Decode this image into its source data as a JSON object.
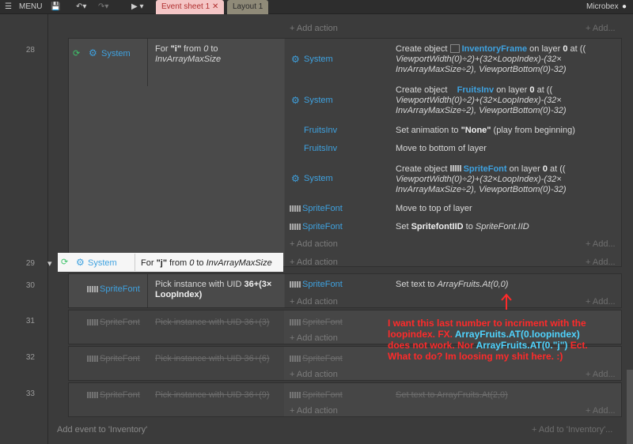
{
  "toolbar": {
    "menu_label": "MENU",
    "tab_active": "Event sheet 1",
    "tab_inactive": "Layout 1",
    "user": "Microbex"
  },
  "events": {
    "e28": {
      "num": "28",
      "cond_object": "System",
      "cond_text_1": "For ",
      "cond_var": "\"i\"",
      "cond_text_2": " from ",
      "cond_from": "0",
      "cond_text_3": " to",
      "cond_to": "InvArrayMaxSize",
      "actions": [
        {
          "object": "System",
          "line1": "Create object",
          "obj": "InventoryFrame",
          "line1b": "on layer",
          "layer": "0",
          "line1c": "at ((",
          "line2": "ViewportWidth(0)÷2)+(32×LoopIndex)-(32×",
          "line3": "InvArrayMaxSize÷2), ViewportBottom(0)-32)"
        },
        {
          "object": "System",
          "line1": "Create object",
          "obj": "FruitsInv",
          "line1b": "on layer",
          "layer": "0",
          "line1c": "at ((",
          "line2": "ViewportWidth(0)÷2)+(32×LoopIndex)-(32×",
          "line3": "InvArrayMaxSize÷2), ViewportBottom(0)-32)"
        },
        {
          "object": "FruitsInv",
          "text": "Set animation to ",
          "value": "\"None\"",
          "rest": " (play from beginning)"
        },
        {
          "object": "FruitsInv",
          "text": "Move to bottom of layer"
        },
        {
          "object": "System",
          "line1": "Create object",
          "obj": "SpriteFont",
          "line1b": "on layer",
          "layer": "0",
          "line1c": "at ((",
          "line2": "ViewportWidth(0)÷2)+(32×LoopIndex)-(32×",
          "line3": "InvArrayMaxSize÷2), ViewportBottom(0)-32)"
        },
        {
          "object": "SpriteFont",
          "text": "Move to top of layer"
        },
        {
          "object": "SpriteFont",
          "text": "Set ",
          "var": "SpritefontIID",
          "rest": " to ",
          "val": "SpriteFont.IID"
        }
      ]
    },
    "e29": {
      "num": "29",
      "cond_object": "System",
      "cond_text": "For ",
      "cond_var": "\"j\"",
      "cond_text_2": " from ",
      "cond_from": "0",
      "cond_text_3": " to ",
      "cond_to": "InvArrayMaxSize"
    },
    "e30": {
      "num": "30",
      "cond_object": "SpriteFont",
      "cond_text": "Pick instance with UID ",
      "cond_value_1": "36+(3×",
      "cond_value_2": "LoopIndex)",
      "act_object": "SpriteFont",
      "act_text": "Set text to ",
      "act_value": "ArrayFruits.At(0,0)"
    },
    "e31": {
      "num": "31",
      "cond_object": "SpriteFont",
      "cond_text": "Pick instance with UID 36+(3)",
      "act_object": "SpriteFont"
    },
    "e32": {
      "num": "32",
      "cond_object": "SpriteFont",
      "cond_text": "Pick instance with UID 36+(6)",
      "act_object": "SpriteFont"
    },
    "e33": {
      "num": "33",
      "cond_object": "SpriteFont",
      "cond_text": "Pick instance with UID 36+(9)",
      "act_object": "SpriteFont",
      "act_text": "Set text to ArrayFruits.At(2,0)"
    }
  },
  "labels": {
    "add_action": "Add action",
    "add_dots": "Add...",
    "add_event": "Add event to 'Inventory'",
    "add_to": "Add to 'Inventory'..."
  },
  "annotation": {
    "l1": "I want this last number to incriment with the",
    "l2": "loopindex. FX. ",
    "l2c": "ArrayFruits.AT(0.loopindex)",
    "l3": "does not work. Nor ",
    "l3c": "ArrayFruits.AT(0.\"j\")",
    "l3e": " Ect.",
    "l4": "What to do? Im loosing my shit here. :)"
  }
}
